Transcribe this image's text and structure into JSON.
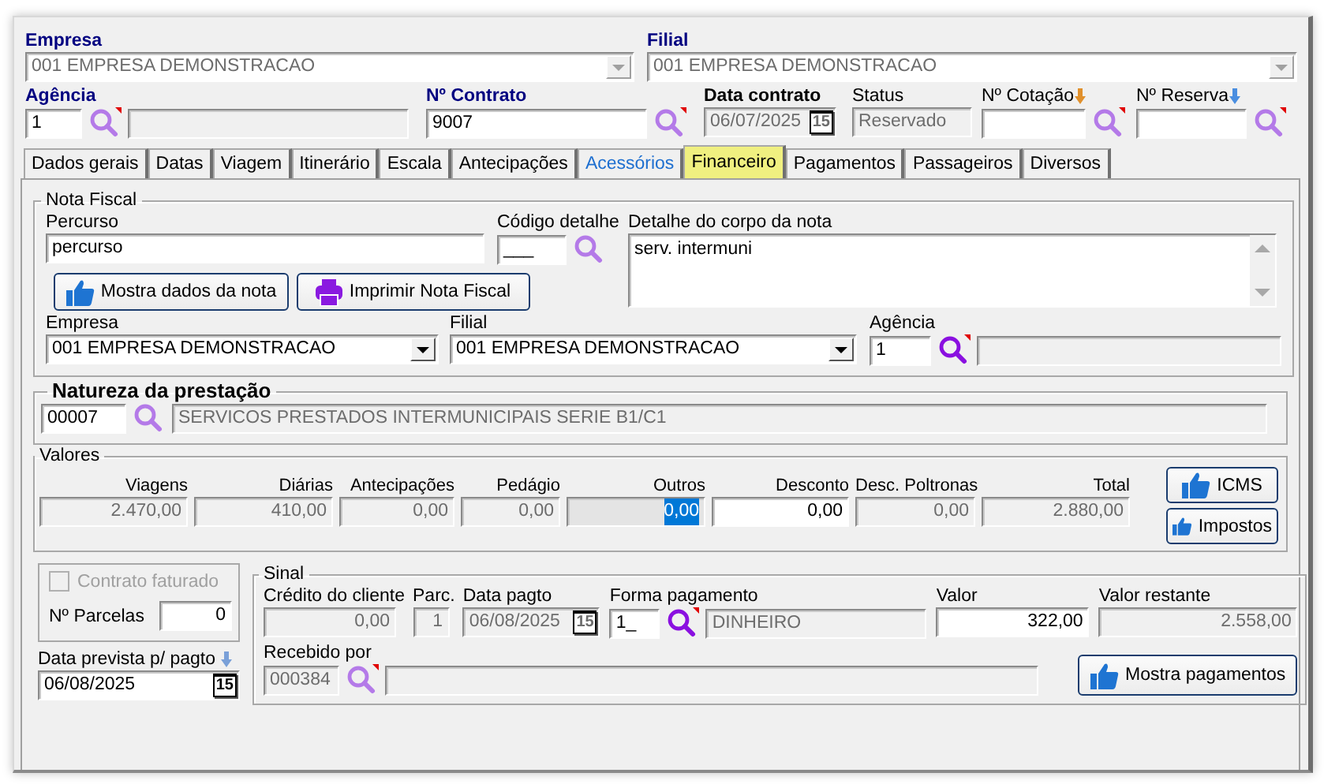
{
  "header": {
    "empresa": {
      "label": "Empresa",
      "value": "001 EMPRESA DEMONSTRACAO"
    },
    "filial": {
      "label": "Filial",
      "value": "001 EMPRESA DEMONSTRACAO"
    },
    "agencia": {
      "label": "Agência",
      "value": "1"
    },
    "contrato": {
      "label": "Nº Contrato",
      "value": "9007"
    },
    "data_contrato": {
      "label": "Data contrato",
      "value": "06/07/2025",
      "calendar": "15"
    },
    "status": {
      "label": "Status",
      "value": "Reservado"
    },
    "cotacao": {
      "label": "Nº Cotação"
    },
    "reserva": {
      "label": "Nº Reserva"
    }
  },
  "tabs": [
    {
      "label": "Dados gerais",
      "selected": false,
      "highlighted": false
    },
    {
      "label": "Datas",
      "selected": false,
      "highlighted": false
    },
    {
      "label": "Viagem",
      "selected": false,
      "highlighted": false
    },
    {
      "label": "Itinerário",
      "selected": false,
      "highlighted": false
    },
    {
      "label": "Escala",
      "selected": false,
      "highlighted": false
    },
    {
      "label": "Antecipações",
      "selected": false,
      "highlighted": false
    },
    {
      "label": "Acessórios",
      "selected": false,
      "highlighted": true
    },
    {
      "label": "Financeiro",
      "selected": true,
      "highlighted": false
    },
    {
      "label": "Pagamentos",
      "selected": false,
      "highlighted": false
    },
    {
      "label": "Passageiros",
      "selected": false,
      "highlighted": false
    },
    {
      "label": "Diversos",
      "selected": false,
      "highlighted": false
    }
  ],
  "nota_fiscal": {
    "title": "Nota Fiscal",
    "percurso": {
      "label": "Percurso",
      "value": "percurso"
    },
    "codigo_detalhe": {
      "label": "Código detalhe",
      "value": "___"
    },
    "detalhe": {
      "label": "Detalhe do corpo da nota",
      "value": "serv. intermuni"
    },
    "buttons": [
      {
        "label": "Mostra dados da nota",
        "kind": "thumb"
      },
      {
        "label": "Imprimir Nota Fiscal",
        "kind": "printer"
      }
    ],
    "empresa": {
      "label": "Empresa",
      "value": "001 EMPRESA DEMONSTRACAO"
    },
    "filial": {
      "label": "Filial",
      "value": "001 EMPRESA DEMONSTRACAO"
    },
    "agencia": {
      "label": "Agência",
      "value": "1"
    }
  },
  "natureza": {
    "title": "Natureza da prestação",
    "code": "00007",
    "description": "SERVICOS PRESTADOS INTERMUNICIPAIS SERIE B1/C1"
  },
  "valores": {
    "title": "Valores",
    "items": [
      {
        "label": "Viagens",
        "value": "2.470,00",
        "editable": false,
        "selected": false
      },
      {
        "label": "Diárias",
        "value": "410,00",
        "editable": false,
        "selected": false
      },
      {
        "label": "Antecipações",
        "value": "0,00",
        "editable": false,
        "selected": false
      },
      {
        "label": "Pedágio",
        "value": "0,00",
        "editable": false,
        "selected": false
      },
      {
        "label": "Outros",
        "value": "0,00",
        "editable": false,
        "selected": true
      },
      {
        "label": "Desconto",
        "value": "0,00",
        "editable": true,
        "selected": false
      },
      {
        "label": "Desc. Poltronas",
        "value": "0,00",
        "editable": false,
        "selected": false
      },
      {
        "label": "Total",
        "value": "2.880,00",
        "editable": false,
        "selected": false
      }
    ],
    "buttons": [
      {
        "label": "ICMS"
      },
      {
        "label": "Impostos"
      }
    ]
  },
  "faturamento": {
    "contrato_faturado": {
      "label": "Contrato faturado",
      "checked": false,
      "disabled": true
    },
    "parcelas": {
      "label": "Nº Parcelas",
      "value": "0"
    },
    "data_prevista": {
      "label": "Data prevista p/ pagto",
      "value": "06/08/2025",
      "calendar": "15"
    }
  },
  "sinal": {
    "title": "Sinal",
    "credito": {
      "label": "Crédito do cliente",
      "value": "0,00"
    },
    "parcela": {
      "label": "Parc.",
      "value": "1"
    },
    "data_pagto": {
      "label": "Data pagto",
      "value": "06/08/2025",
      "calendar": "15"
    },
    "forma": {
      "label": "Forma pagamento",
      "code": "1_",
      "description": "DINHEIRO"
    },
    "valor": {
      "label": "Valor",
      "value": "322,00"
    },
    "valor_restante": {
      "label": "Valor restante",
      "value": "2.558,00"
    },
    "recebido": {
      "label": "Recebido por",
      "code": "000384"
    },
    "button": {
      "label": "Mostra pagamentos"
    }
  }
}
